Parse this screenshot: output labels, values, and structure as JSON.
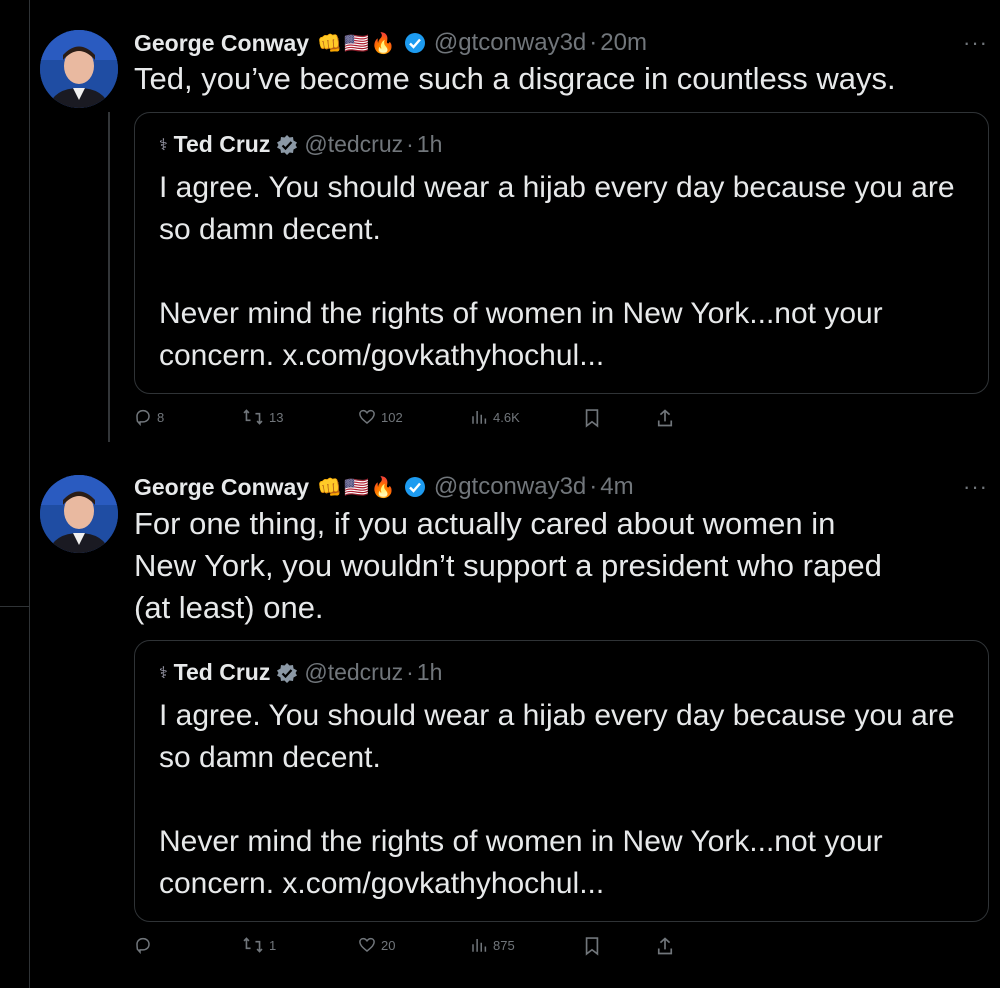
{
  "tweets": [
    {
      "author_name": "George Conway",
      "author_emoji": "👊🇺🇸🔥",
      "author_handle": "@gtconway3d",
      "separator": "·",
      "time": "20m",
      "more": "···",
      "text": "Ted, you’ve become such a disgrace in countless ways.",
      "quote": {
        "flag": "⚕",
        "author_name": "Ted Cruz",
        "author_handle": "@tedcruz",
        "separator": "·",
        "time": "1h",
        "text": "I agree. You should wear a hijab every day because you are so damn decent.\n\nNever mind the rights of women in New York...not your concern. x.com/govkathyhochul..."
      },
      "actions": {
        "replies": "8",
        "retweets": "13",
        "likes": "102",
        "views": "4.6K"
      }
    },
    {
      "author_name": "George Conway",
      "author_emoji": "👊🇺🇸🔥",
      "author_handle": "@gtconway3d",
      "separator": "·",
      "time": "4m",
      "more": "···",
      "text": "For one thing, if you actually cared about women in\nNew York, you wouldn’t support a president who raped\n(at least) one.",
      "quote": {
        "flag": "⚕",
        "author_name": "Ted Cruz",
        "author_handle": "@tedcruz",
        "separator": "·",
        "time": "1h",
        "text": "I agree. You should wear a hijab every day because you are so damn decent.\n\nNever mind the rights of women in New York...not your concern. x.com/govkathyhochul..."
      },
      "actions": {
        "replies": "",
        "retweets": "1",
        "likes": "20",
        "views": "875"
      }
    }
  ],
  "colors": {
    "background": "#000000",
    "text": "#e7e9ea",
    "muted": "#71767b",
    "border": "#2f3336",
    "verified": "#1d9bf0"
  }
}
